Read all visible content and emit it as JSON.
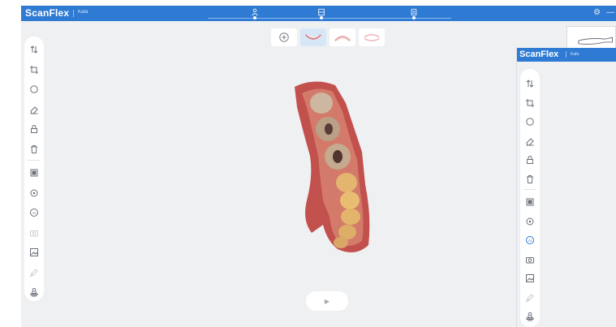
{
  "app": {
    "name": "ScanFlex",
    "subtitle": "Kafa",
    "accent": "#2f7bd4",
    "background": "#eef0f2"
  },
  "steps": [
    {
      "icon": "patient-icon"
    },
    {
      "icon": "scan-icon"
    },
    {
      "icon": "export-icon"
    }
  ],
  "window_controls": [
    {
      "icon": "settings-icon",
      "glyph": "⚙"
    },
    {
      "icon": "minimize-icon",
      "glyph": "—"
    }
  ],
  "left_tools": [
    {
      "icon": "sort-icon",
      "state": "normal"
    },
    {
      "icon": "crop-icon",
      "state": "normal"
    },
    {
      "icon": "lasso-icon",
      "state": "normal"
    },
    {
      "icon": "eraser-icon",
      "state": "normal"
    },
    {
      "icon": "lock-icon",
      "state": "normal"
    },
    {
      "icon": "trash-icon",
      "state": "normal"
    },
    {
      "icon": "texture-icon",
      "state": "normal"
    },
    {
      "icon": "target-icon",
      "state": "normal"
    },
    {
      "icon": "ai-icon",
      "state": "normal"
    },
    {
      "icon": "camera-icon",
      "state": "faded"
    },
    {
      "icon": "image-icon",
      "state": "normal"
    },
    {
      "icon": "brush-icon",
      "state": "faded"
    },
    {
      "icon": "stamp-icon",
      "state": "normal"
    }
  ],
  "inset_tools": [
    {
      "icon": "sort-icon",
      "state": "normal"
    },
    {
      "icon": "crop-icon",
      "state": "normal"
    },
    {
      "icon": "lasso-icon",
      "state": "normal"
    },
    {
      "icon": "eraser-icon",
      "state": "normal"
    },
    {
      "icon": "lock-icon",
      "state": "normal"
    },
    {
      "icon": "trash-icon",
      "state": "normal"
    },
    {
      "icon": "texture-icon",
      "state": "normal"
    },
    {
      "icon": "target-icon",
      "state": "normal"
    },
    {
      "icon": "ai-icon",
      "state": "active"
    },
    {
      "icon": "camera-icon",
      "state": "normal"
    },
    {
      "icon": "image-icon",
      "state": "normal"
    },
    {
      "icon": "brush-icon",
      "state": "faded"
    },
    {
      "icon": "stamp-icon",
      "state": "normal"
    }
  ],
  "jaw_buttons": [
    {
      "icon": "add-icon",
      "state": "normal"
    },
    {
      "icon": "lower-jaw-icon",
      "state": "active"
    },
    {
      "icon": "upper-jaw-icon",
      "state": "normal"
    },
    {
      "icon": "bite-icon",
      "state": "normal"
    }
  ],
  "play": {
    "icon": "play-icon",
    "glyph": "▶"
  }
}
